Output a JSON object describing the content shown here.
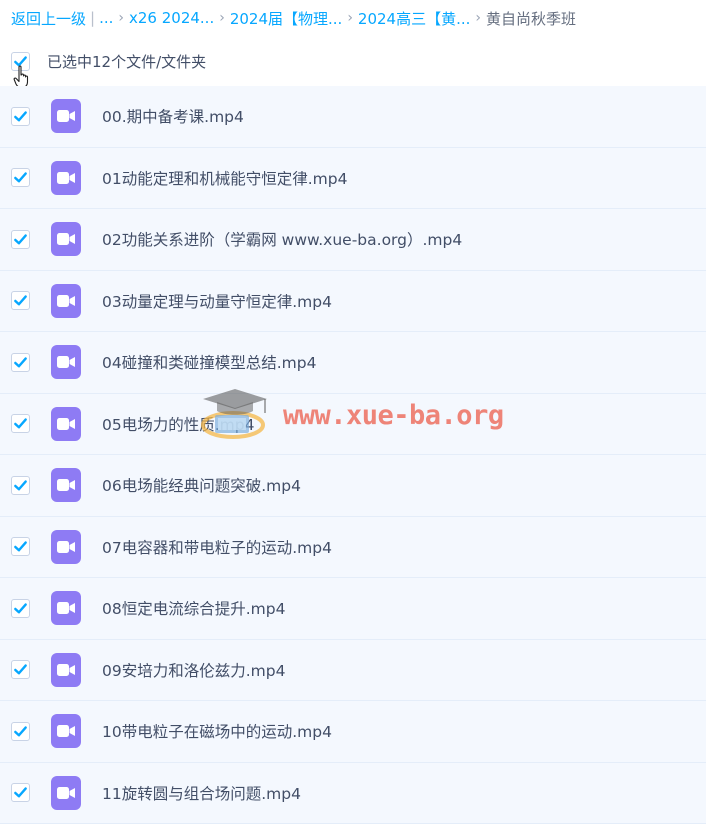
{
  "breadcrumb": {
    "back": "返回上一级",
    "ellipsis": "...",
    "items": [
      "x26 2024...",
      "2024届【物理...",
      "2024高三【黄..."
    ],
    "current": "黄自尚秋季班"
  },
  "selection": {
    "label": "已选中12个文件/文件夹",
    "all_checked": true
  },
  "files": [
    {
      "name": "00.期中备考课.mp4",
      "checked": true
    },
    {
      "name": "01动能定理和机械能守恒定律.mp4",
      "checked": true
    },
    {
      "name": "02功能关系进阶（学霸网 www.xue-ba.org）.mp4",
      "checked": true
    },
    {
      "name": "03动量定理与动量守恒定律.mp4",
      "checked": true
    },
    {
      "name": "04碰撞和类碰撞模型总结.mp4",
      "checked": true
    },
    {
      "name": "05电场力的性质.mp4",
      "checked": true
    },
    {
      "name": "06电场能经典问题突破.mp4",
      "checked": true
    },
    {
      "name": "07电容器和带电粒子的运动.mp4",
      "checked": true
    },
    {
      "name": "08恒定电流综合提升.mp4",
      "checked": true
    },
    {
      "name": "09安培力和洛伦兹力.mp4",
      "checked": true
    },
    {
      "name": "10带电粒子在磁场中的运动.mp4",
      "checked": true
    },
    {
      "name": "11旋转圆与组合场问题.mp4",
      "checked": true
    }
  ],
  "watermark": {
    "text": "www.xue-ba.org"
  },
  "colors": {
    "link": "#06a7ff",
    "check": "#06a7ff",
    "video_icon": "#8e7bf4",
    "row_bg": "#f4f8fe"
  }
}
